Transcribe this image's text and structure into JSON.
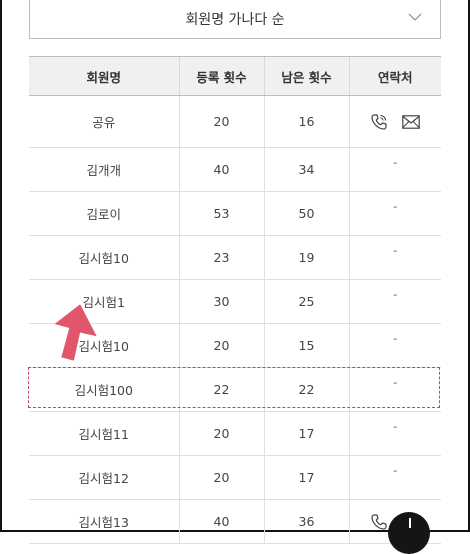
{
  "sort": {
    "label": "회원명 가나다 순"
  },
  "table": {
    "headers": [
      "회원명",
      "등록 횟수",
      "남은 횟수",
      "연락처"
    ],
    "rows": [
      {
        "name": "공유",
        "registered": "20",
        "remaining": "16",
        "contact": ""
      },
      {
        "name": "김개개",
        "registered": "40",
        "remaining": "34",
        "contact": "-"
      },
      {
        "name": "김로이",
        "registered": "53",
        "remaining": "50",
        "contact": "-"
      },
      {
        "name": "김시험10",
        "registered": "23",
        "remaining": "19",
        "contact": "-"
      },
      {
        "name": "김시험1",
        "registered": "30",
        "remaining": "25",
        "contact": "-"
      },
      {
        "name": "김시험10",
        "registered": "20",
        "remaining": "15",
        "contact": "-"
      },
      {
        "name": "김시험100",
        "registered": "22",
        "remaining": "22",
        "contact": "-"
      },
      {
        "name": "김시험11",
        "registered": "20",
        "remaining": "17",
        "contact": "-"
      },
      {
        "name": "김시험12",
        "registered": "20",
        "remaining": "17",
        "contact": "-"
      },
      {
        "name": "김시험13",
        "registered": "40",
        "remaining": "36",
        "contact": ""
      }
    ]
  },
  "colors": {
    "arrow": "#e0566a",
    "highlight": "#c2475c"
  }
}
